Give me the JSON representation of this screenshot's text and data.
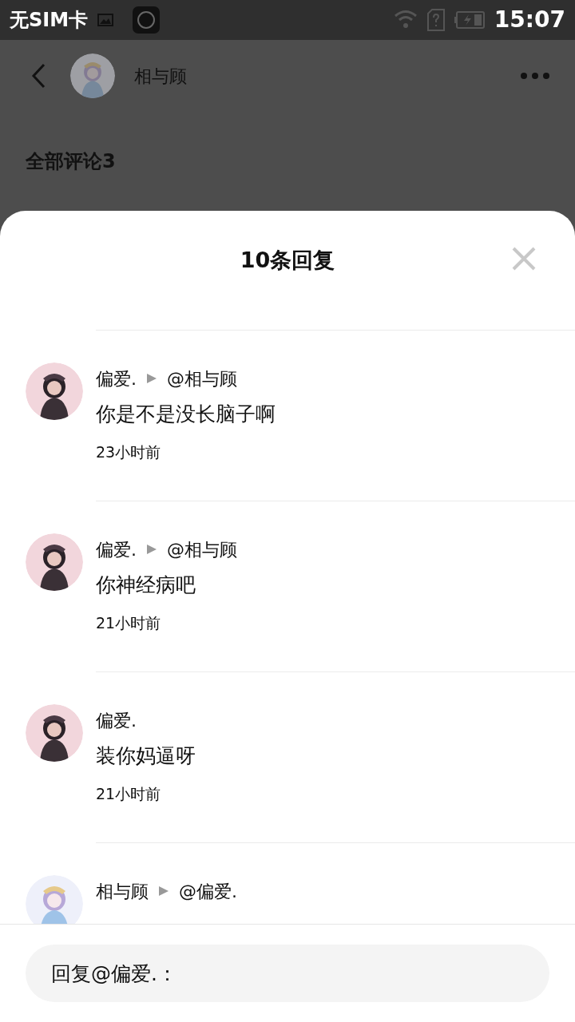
{
  "status_bar": {
    "carrier": "无SIM卡",
    "time": "15:07"
  },
  "header": {
    "title": "相与顾"
  },
  "section_title": "全部评论3",
  "sheet": {
    "title": "10条回复"
  },
  "replies": [
    {
      "author": "偏爱.",
      "reply_to": "@相与顾",
      "text": "你是不是没长脑子啊",
      "time": "23小时前"
    },
    {
      "author": "偏爱.",
      "reply_to": "@相与顾",
      "text": "你神经病吧",
      "time": "21小时前"
    },
    {
      "author": "偏爱.",
      "text": "装你妈逼呀",
      "time": "21小时前"
    },
    {
      "author": "相与顾",
      "reply_to": "@偏爱."
    }
  ],
  "reply_field": {
    "placeholder": "回复@偏爱.："
  }
}
